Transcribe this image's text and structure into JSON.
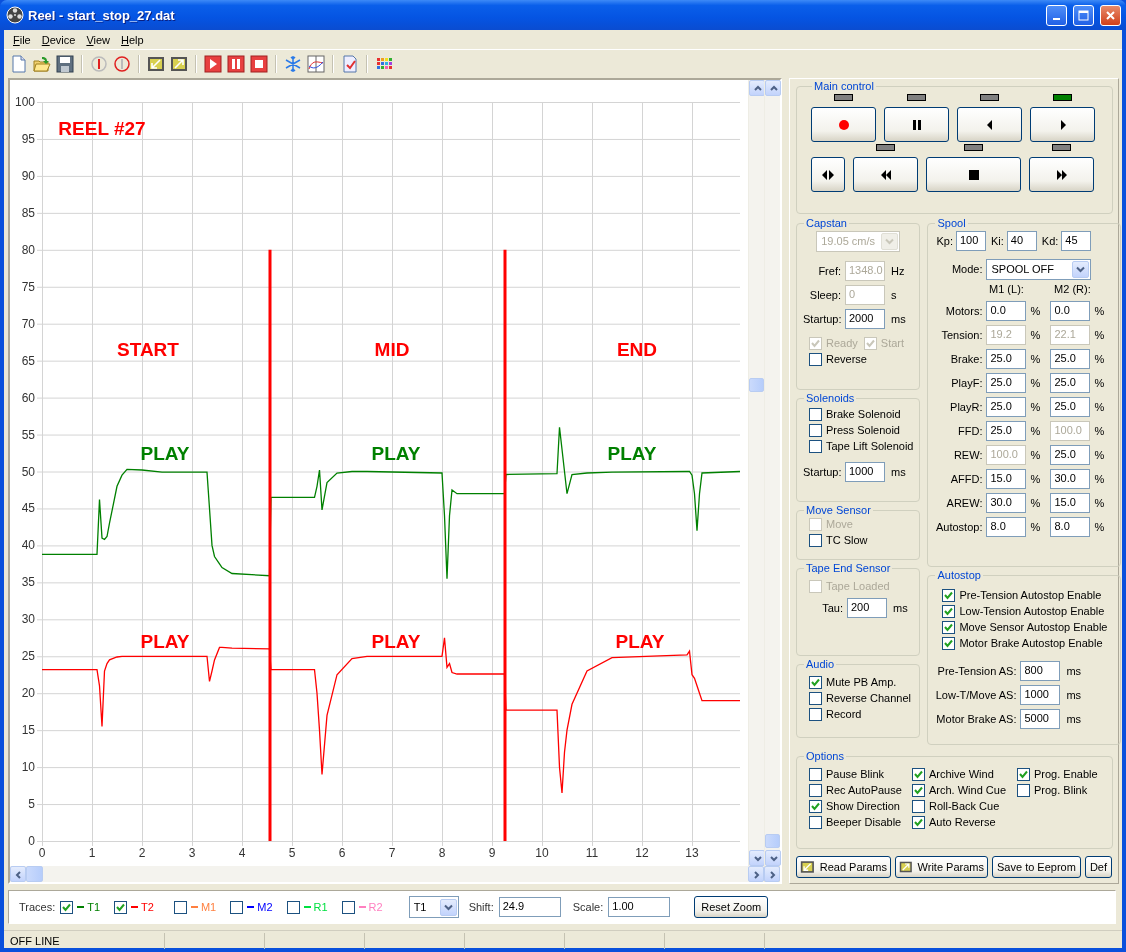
{
  "window": {
    "title": "Reel - start_stop_27.dat"
  },
  "menu": [
    {
      "label": "File"
    },
    {
      "label": "Device"
    },
    {
      "label": "View"
    },
    {
      "label": "Help"
    }
  ],
  "chart": {
    "chart_data": {
      "type": "line",
      "x": [
        0,
        1.1,
        1.15,
        1.2,
        1.25,
        1.3,
        1.35,
        1.5,
        1.6,
        1.7,
        2.0,
        2.4,
        3.3,
        3.35,
        3.4,
        3.45,
        3.55,
        3.6,
        3.8,
        4.55,
        4.58,
        5.45,
        5.5,
        5.55,
        5.6,
        5.7,
        5.9,
        6.2,
        6.5,
        8.0,
        8.05,
        8.1,
        8.15,
        8.2,
        8.3,
        9.25,
        9.28,
        10.3,
        10.35,
        10.4,
        10.45,
        10.5,
        10.6,
        10.9,
        11.4,
        12.9,
        12.95,
        13.0,
        13.05,
        13.1,
        13.15,
        13.2,
        13.96
      ],
      "series": [
        {
          "color": "#008000",
          "values": [
            38.8,
            38.8,
            46.2,
            41,
            40.8,
            41.2,
            43,
            48,
            49.5,
            50.3,
            50.2,
            49.9,
            49.9,
            45,
            40,
            38.5,
            37.5,
            37,
            36.2,
            35.9,
            46.5,
            46.5,
            48,
            50.2,
            44.8,
            48.5,
            49.8,
            50,
            50,
            49.8,
            44,
            35.5,
            44,
            47.5,
            47,
            47,
            49.6,
            49.7,
            56,
            53,
            50,
            47,
            49.6,
            49.8,
            49.9,
            50,
            50,
            49.5,
            47,
            42,
            47,
            49.8,
            50
          ]
        },
        {
          "color": "#ff0000",
          "values": [
            23.2,
            23.2,
            21,
            15.5,
            23,
            24,
            24.5,
            24.9,
            25,
            25,
            25,
            25,
            25,
            21.6,
            23,
            24.5,
            26.2,
            26.2,
            26.1,
            26,
            23.2,
            23.2,
            20,
            15,
            9,
            17,
            22.5,
            24.7,
            25,
            25,
            27.5,
            23.5,
            24,
            22.8,
            22.6,
            22.6,
            17.7,
            17.7,
            10,
            6.5,
            12,
            15,
            18.5,
            23,
            24.8,
            25.2,
            25.7,
            22.5,
            22,
            21,
            20,
            19,
            19
          ]
        }
      ],
      "xlim": [
        0,
        13.96
      ],
      "ylim": [
        0,
        100
      ],
      "xticks": [
        0,
        1,
        2,
        3,
        4,
        5,
        6,
        7,
        8,
        9,
        10,
        11,
        12,
        13
      ],
      "yticks": [
        0,
        5,
        10,
        15,
        20,
        25,
        30,
        35,
        40,
        45,
        50,
        55,
        60,
        65,
        70,
        75,
        80,
        85,
        90,
        95,
        100
      ],
      "grid": true,
      "annotations": [
        "REEL #27",
        "START",
        "MID",
        "END",
        "PLAY",
        "PLAY",
        "PLAY",
        "PLAY",
        "PLAY",
        "PLAY"
      ],
      "ref_lines": [
        {
          "axis": "x",
          "value": 4.56
        },
        {
          "axis": "x",
          "value": 9.26
        }
      ]
    }
  },
  "main_control": {
    "title": "Main control",
    "rows": [
      [
        {
          "kind": "record",
          "lit": false
        },
        {
          "kind": "pause",
          "lit": false
        },
        {
          "kind": "reverse",
          "lit": false
        },
        {
          "kind": "play",
          "lit": true
        }
      ],
      [
        {
          "kind": "direction"
        },
        {
          "kind": "rewind",
          "lit": false
        },
        {
          "kind": "stop",
          "lit": false
        },
        {
          "kind": "fast-forward",
          "lit": false
        }
      ]
    ]
  },
  "capstan": {
    "title": "Capstan",
    "items": [
      {
        "kind": "select",
        "value": "19.05 cm/s",
        "disabled": true
      },
      {
        "kind": "field",
        "label": "Fref:",
        "value": "1348.0",
        "unit": "Hz",
        "disabled": true
      },
      {
        "kind": "field",
        "label": "Sleep:",
        "value": "0",
        "unit": "s",
        "disabled": true
      },
      {
        "kind": "field",
        "label": "Startup:",
        "value": "2000",
        "unit": "ms",
        "disabled": false
      },
      {
        "kind": "checks",
        "checks": [
          {
            "label": "Ready",
            "checked": true,
            "disabled": true
          },
          {
            "label": "Start",
            "checked": true,
            "disabled": true
          }
        ]
      },
      {
        "kind": "checks",
        "checks": [
          {
            "label": "Reverse",
            "checked": false,
            "disabled": false
          }
        ]
      }
    ]
  },
  "solenoids": {
    "title": "Solenoids",
    "items": [
      {
        "kind": "checks",
        "checks": [
          {
            "label": "Brake Solenoid",
            "checked": false,
            "disabled": false
          }
        ]
      },
      {
        "kind": "checks",
        "checks": [
          {
            "label": "Press Solenoid",
            "checked": false,
            "disabled": false
          }
        ]
      },
      {
        "kind": "checks",
        "checks": [
          {
            "label": "Tape Lift Solenoid",
            "checked": false,
            "disabled": false
          }
        ]
      },
      {
        "kind": "field",
        "label": "Startup:",
        "value": "1000",
        "unit": "ms",
        "disabled": false
      }
    ]
  },
  "move_sensor": {
    "title": "Move Sensor",
    "items": [
      {
        "kind": "checks",
        "checks": [
          {
            "label": "Move",
            "checked": false,
            "disabled": true
          }
        ]
      },
      {
        "kind": "checks",
        "checks": [
          {
            "label": "TC Slow",
            "checked": false,
            "disabled": false
          }
        ]
      }
    ]
  },
  "tape_end_sensor": {
    "title": "Tape End Sensor",
    "items": [
      {
        "kind": "checks",
        "checks": [
          {
            "label": "Tape Loaded",
            "checked": false,
            "disabled": true
          }
        ]
      },
      {
        "kind": "field",
        "label": "Tau:",
        "value": "200",
        "unit": "ms",
        "disabled": false
      }
    ]
  },
  "audio": {
    "title": "Audio",
    "items": [
      {
        "kind": "checks",
        "checks": [
          {
            "label": "Mute PB Amp.",
            "checked": true,
            "disabled": false
          }
        ]
      },
      {
        "kind": "checks",
        "checks": [
          {
            "label": "Reverse Channel",
            "checked": false,
            "disabled": false
          }
        ]
      },
      {
        "kind": "checks",
        "checks": [
          {
            "label": "Record",
            "checked": false,
            "disabled": false
          }
        ]
      }
    ]
  },
  "spool": {
    "title": "Spool",
    "items": [
      {
        "kind": "params",
        "fields": [
          {
            "label": "Kp:",
            "value": "100"
          },
          {
            "label": "Ki:",
            "value": "40"
          },
          {
            "label": "Kd:",
            "value": "45"
          }
        ]
      },
      {
        "kind": "select",
        "label": "Mode:",
        "value": "SPOOL OFF",
        "disabled": false
      },
      {
        "kind": "headers",
        "labels": [
          "M1 (L):",
          "M2 (R):"
        ]
      },
      {
        "kind": "pair",
        "label": "Motors:",
        "cells": [
          {
            "value": "0.0",
            "unit": "%",
            "disabled": false
          },
          {
            "value": "0.0",
            "unit": "%",
            "disabled": false
          }
        ]
      },
      {
        "kind": "pair",
        "label": "Tension:",
        "cells": [
          {
            "value": "19.2",
            "unit": "%",
            "disabled": true
          },
          {
            "value": "22.1",
            "unit": "%",
            "disabled": true
          }
        ]
      },
      {
        "kind": "pair",
        "label": "Brake:",
        "cells": [
          {
            "value": "25.0",
            "unit": "%",
            "disabled": false
          },
          {
            "value": "25.0",
            "unit": "%",
            "disabled": false
          }
        ]
      },
      {
        "kind": "pair",
        "label": "PlayF:",
        "cells": [
          {
            "value": "25.0",
            "unit": "%",
            "disabled": false
          },
          {
            "value": "25.0",
            "unit": "%",
            "disabled": false
          }
        ]
      },
      {
        "kind": "pair",
        "label": "PlayR:",
        "cells": [
          {
            "value": "25.0",
            "unit": "%",
            "disabled": false
          },
          {
            "value": "25.0",
            "unit": "%",
            "disabled": false
          }
        ]
      },
      {
        "kind": "pair",
        "label": "FFD:",
        "cells": [
          {
            "value": "25.0",
            "unit": "%",
            "disabled": false
          },
          {
            "value": "100.0",
            "unit": "%",
            "disabled": true
          }
        ]
      },
      {
        "kind": "pair",
        "label": "REW:",
        "cells": [
          {
            "value": "100.0",
            "unit": "%",
            "disabled": true
          },
          {
            "value": "25.0",
            "unit": "%",
            "disabled": false
          }
        ]
      },
      {
        "kind": "pair",
        "label": "AFFD:",
        "cells": [
          {
            "value": "15.0",
            "unit": "%",
            "disabled": false
          },
          {
            "value": "30.0",
            "unit": "%",
            "disabled": false
          }
        ]
      },
      {
        "kind": "pair",
        "label": "AREW:",
        "cells": [
          {
            "value": "30.0",
            "unit": "%",
            "disabled": false
          },
          {
            "value": "15.0",
            "unit": "%",
            "disabled": false
          }
        ]
      },
      {
        "kind": "pair",
        "label": "Autostop:",
        "cells": [
          {
            "value": "8.0",
            "unit": "%",
            "disabled": false
          },
          {
            "value": "8.0",
            "unit": "%",
            "disabled": false
          }
        ]
      }
    ]
  },
  "autostop": {
    "title": "Autostop",
    "items": [
      {
        "kind": "checks",
        "checks": [
          {
            "label": "Pre-Tension Autostop Enable",
            "checked": true,
            "disabled": false
          }
        ]
      },
      {
        "kind": "checks",
        "checks": [
          {
            "label": "Low-Tension Autostop Enable",
            "checked": true,
            "disabled": false
          }
        ]
      },
      {
        "kind": "checks",
        "checks": [
          {
            "label": "Move Sensor Autostop Enable",
            "checked": true,
            "disabled": false
          }
        ]
      },
      {
        "kind": "checks",
        "checks": [
          {
            "label": "Motor Brake Autostop Enable",
            "checked": true,
            "disabled": false
          }
        ]
      },
      {
        "kind": "field",
        "label": "Pre-Tension AS:",
        "value": "800",
        "unit": "ms",
        "disabled": false
      },
      {
        "kind": "field",
        "label": "Low-T/Move AS:",
        "value": "1000",
        "unit": "ms",
        "disabled": false
      },
      {
        "kind": "field",
        "label": "Motor Brake AS:",
        "value": "5000",
        "unit": "ms",
        "disabled": false
      }
    ]
  },
  "options": {
    "title": "Options",
    "items": [
      {
        "kind": "columns",
        "columns": [
          [
            {
              "label": "Pause Blink",
              "checked": false,
              "disabled": false
            },
            {
              "label": "Rec AutoPause",
              "checked": false,
              "disabled": false
            },
            {
              "label": "Show Direction",
              "checked": true,
              "disabled": false
            },
            {
              "label": "Beeper Disable",
              "checked": false,
              "disabled": false
            }
          ],
          [
            {
              "label": "Archive Wind",
              "checked": true,
              "disabled": false
            },
            {
              "label": "Arch. Wind Cue",
              "checked": true,
              "disabled": false
            },
            {
              "label": "Roll-Back Cue",
              "checked": false,
              "disabled": false
            },
            {
              "label": "Auto Reverse",
              "checked": true,
              "disabled": false
            }
          ],
          [
            {
              "label": "Prog. Enable",
              "checked": true,
              "disabled": false
            },
            {
              "label": "Prog. Blink",
              "checked": false,
              "disabled": false
            }
          ]
        ]
      }
    ]
  },
  "param_buttons": [
    {
      "kind": "read",
      "label": "Read Params"
    },
    {
      "kind": "write",
      "label": "Write Params"
    },
    {
      "kind": "plain",
      "label": "Save to Eeprom"
    },
    {
      "kind": "plain",
      "label": "Def"
    }
  ],
  "traces_bar": {
    "label": "Traces:",
    "traces": [
      {
        "label": "T1",
        "color": "#008000",
        "checked": true
      },
      {
        "label": "T2",
        "color": "#ff0000",
        "checked": true
      },
      {
        "label": "M1",
        "color": "#ff8040",
        "checked": false
      },
      {
        "label": "M2",
        "color": "#0000ff",
        "checked": false
      },
      {
        "label": "R1",
        "color": "#00e040",
        "checked": false
      },
      {
        "label": "R2",
        "color": "#ff80c0",
        "checked": false
      }
    ],
    "channel": {
      "value": "T1"
    },
    "shift": {
      "label": "Shift:",
      "value": "24.9"
    },
    "scale": {
      "label": "Scale:",
      "value": "1.00"
    },
    "reset_button": "Reset Zoom"
  },
  "status_bar": {
    "text": "OFF LINE"
  }
}
